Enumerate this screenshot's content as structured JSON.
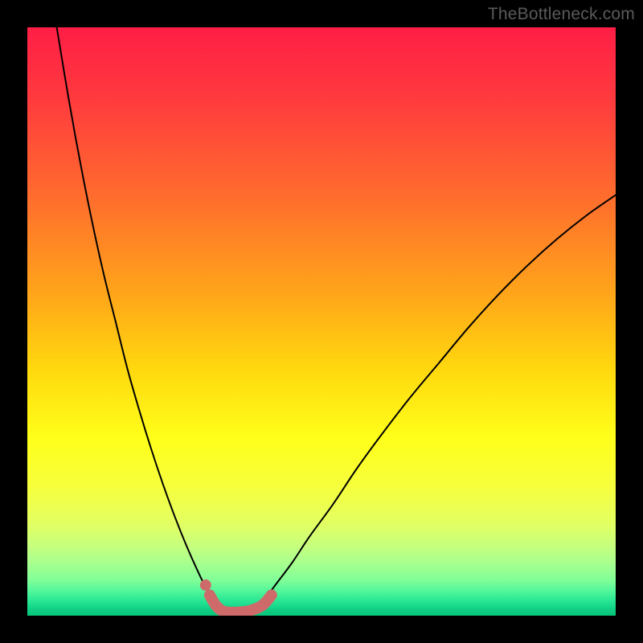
{
  "watermark": {
    "text": "TheBottleneck.com"
  },
  "chart_data": {
    "type": "line",
    "title": "",
    "xlabel": "",
    "ylabel": "",
    "xlim": [
      0,
      100
    ],
    "ylim": [
      0,
      100
    ],
    "grid": false,
    "legend": false,
    "series": [
      {
        "name": "left-curve",
        "stroke": "#000000",
        "stroke_width": 2,
        "x": [
          5,
          7,
          9,
          11,
          13,
          15,
          17,
          19,
          21,
          23,
          25,
          27,
          29,
          30.5,
          32
        ],
        "y": [
          100,
          88,
          77,
          67,
          58,
          50,
          42,
          35,
          28.5,
          22.5,
          17,
          12,
          7.5,
          4.5,
          2.2
        ]
      },
      {
        "name": "right-curve",
        "stroke": "#000000",
        "stroke_width": 2,
        "x": [
          40,
          42,
          45,
          48,
          52,
          56,
          60,
          65,
          70,
          75,
          80,
          85,
          90,
          95,
          100
        ],
        "y": [
          2.2,
          5,
          9,
          13.5,
          19,
          25,
          30.5,
          37,
          43,
          49,
          54.5,
          59.5,
          64,
          68,
          71.5
        ]
      },
      {
        "name": "bottom-band",
        "stroke": "#cf6a6a",
        "stroke_width": 14,
        "x": [
          31,
          32,
          33,
          34,
          36,
          38,
          40,
          41.5
        ],
        "y": [
          3.5,
          1.8,
          0.9,
          0.6,
          0.6,
          0.9,
          1.8,
          3.5
        ]
      },
      {
        "name": "top-dot",
        "type": "scatter",
        "fill": "#cf6a6a",
        "x": [
          30.3
        ],
        "y": [
          5.2
        ],
        "r": 7
      }
    ]
  }
}
